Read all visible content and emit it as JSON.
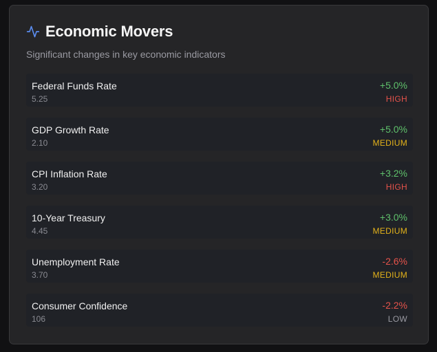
{
  "header": {
    "title": "Economic Movers",
    "subtitle": "Significant changes in key economic indicators",
    "icon": "activity-icon"
  },
  "colors": {
    "positive": "#5fc16b",
    "negative": "#e5534b",
    "high": "#e5534b",
    "medium": "#e3b21a",
    "low": "#9a9aa2",
    "icon": "#5b8def"
  },
  "indicators": [
    {
      "name": "Federal Funds Rate",
      "value": "5.25",
      "change": "+5.0%",
      "direction": "up",
      "impact": "HIGH",
      "level": "high"
    },
    {
      "name": "GDP Growth Rate",
      "value": "2.10",
      "change": "+5.0%",
      "direction": "up",
      "impact": "MEDIUM",
      "level": "medium"
    },
    {
      "name": "CPI Inflation Rate",
      "value": "3.20",
      "change": "+3.2%",
      "direction": "up",
      "impact": "HIGH",
      "level": "high"
    },
    {
      "name": "10-Year Treasury",
      "value": "4.45",
      "change": "+3.0%",
      "direction": "up",
      "impact": "MEDIUM",
      "level": "medium"
    },
    {
      "name": "Unemployment Rate",
      "value": "3.70",
      "change": "-2.6%",
      "direction": "down",
      "impact": "MEDIUM",
      "level": "medium"
    },
    {
      "name": "Consumer Confidence",
      "value": "106",
      "change": "-2.2%",
      "direction": "down",
      "impact": "LOW",
      "level": "low"
    }
  ]
}
